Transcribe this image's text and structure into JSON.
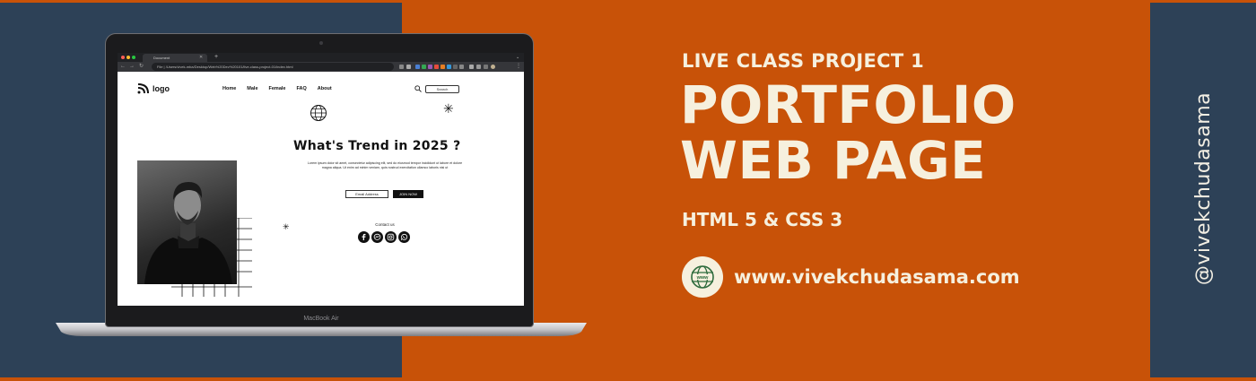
{
  "colors": {
    "navy": "#2d4157",
    "orange": "#c85208",
    "cream": "#f6f0de",
    "browser_dark": "#202124"
  },
  "banner": {
    "subtitle": "LIVE CLASS PROJECT 1",
    "title_line1": "PORTFOLIO",
    "title_line2": "WEB PAGE",
    "tech": "HTML 5 & CSS 3",
    "website_icon": "globe-www-icon",
    "website": "www.vivekchudasama.com",
    "handle": "@vivekchudasama"
  },
  "laptop": {
    "model_label": "MacBook Air",
    "browser": {
      "tab_title": "Document",
      "url": "File | /Users/vivek-mba/Desktop/Web%20Dev%20101/live-class-project-01/index.html"
    }
  },
  "mockup": {
    "logo_text": "logo",
    "logo_icon": "wifi-rss-icon",
    "nav": [
      "Home",
      "Male",
      "Female",
      "FAQ",
      "About"
    ],
    "search_label": "Search",
    "heading": "What's Trend in 2025 ?",
    "paragraph": "Lorem ipsum dolor sit amet, consectetur adipiscing elit, sed do eiusmod tempor incididunt ut labore et dolore magna aliqua. Ut enim ad minim veniam, quis nostrud exercitation ullamco laboris nisi ut",
    "email_placeholder": "Email Address",
    "join_label": "JOIN NOW",
    "contact_label": "Contact us",
    "social_icons": [
      "facebook-icon",
      "messenger-icon",
      "instagram-icon",
      "whatsapp-icon"
    ]
  }
}
